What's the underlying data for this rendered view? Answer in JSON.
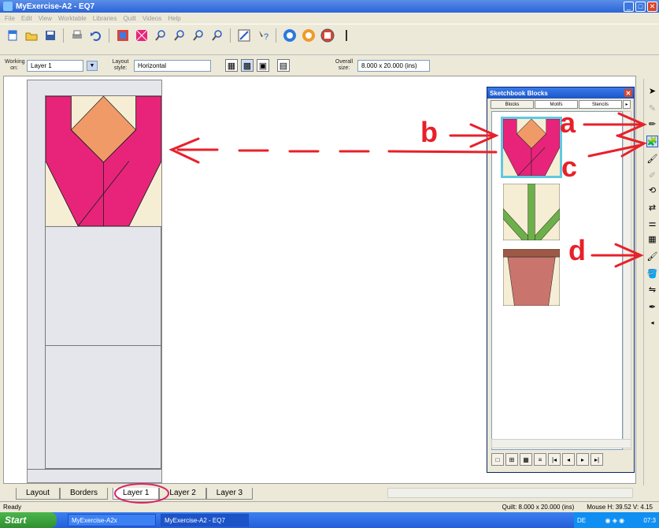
{
  "window": {
    "title": "MyExercise-A2 - EQ7"
  },
  "menu": [
    "File",
    "Edit",
    "View",
    "Worktable",
    "Libraries",
    "Quilt",
    "Videos",
    "Help"
  ],
  "layout_controls": {
    "working_on_label": "Working on:",
    "working_on_value": "Layer 1",
    "layout_style_label": "Layout style:",
    "layout_style_value": "Horizontal",
    "overall_size_label": "Overall size:",
    "overall_size_value": "8.000 x 20.000 (ins)"
  },
  "sketchbook": {
    "title": "Sketchbook Blocks",
    "tabs": [
      "Blocks",
      "Motifs",
      "Stencils"
    ],
    "active_tab": "Blocks"
  },
  "annotations": {
    "a": "a",
    "b": "b",
    "c": "c",
    "d": "d"
  },
  "colors": {
    "block_pink": "#e8247a",
    "block_peach": "#f09a68",
    "block_cream": "#f6eed4",
    "leaf_green": "#6db04a",
    "pot_rose": "#c9756e",
    "pot_rim": "#9c5a46",
    "arrow_red": "#e8202a",
    "tab_circle": "#d6246a"
  },
  "tabs": [
    "Layout",
    "Borders",
    "Layer 1",
    "Layer 2",
    "Layer 3"
  ],
  "active_tab": "Layer 1",
  "status": {
    "ready": "Ready",
    "quilt_size": "Quilt: 8.000 x 20.000 (ins)",
    "mouse": "Mouse H: 39.52   V: 4.15"
  },
  "taskbar": {
    "start": "Start",
    "tasks": [
      "MyExercise-A2x",
      "MyExercise-A2 - EQ7"
    ],
    "tray_lang": "DE",
    "clock": "07:3"
  }
}
